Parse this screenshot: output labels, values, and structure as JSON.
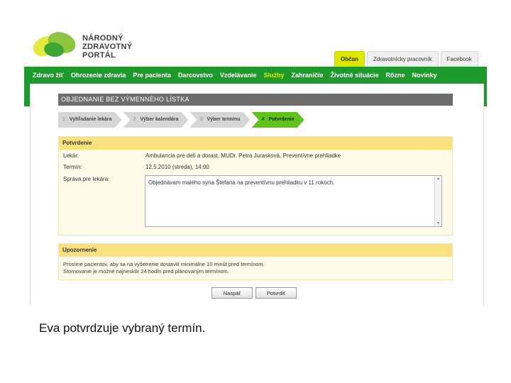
{
  "logo": {
    "line1": "NÁRODNÝ",
    "line2": "ZDRAVOTNÝ",
    "line3": "PORTÁL"
  },
  "top_tabs": [
    {
      "label": "Občan",
      "active": true
    },
    {
      "label": "Zdravotnícky pracovník",
      "active": false
    },
    {
      "label": "Facebook",
      "active": false
    }
  ],
  "nav": [
    {
      "label": "Zdravo žiť",
      "active": false
    },
    {
      "label": "Ohrozenie zdravia",
      "active": false
    },
    {
      "label": "Pre pacienta",
      "active": false
    },
    {
      "label": "Darcovstvo",
      "active": false
    },
    {
      "label": "Vzdelávanie",
      "active": false
    },
    {
      "label": "Služby",
      "active": true
    },
    {
      "label": "Zahraničie",
      "active": false
    },
    {
      "label": "Životné situácie",
      "active": false
    },
    {
      "label": "Rôzne",
      "active": false
    },
    {
      "label": "Novinky",
      "active": false
    }
  ],
  "page_title": "OBJEDNANIE BEZ VÝMENNÉHO LÍSTKA",
  "steps": [
    {
      "num": "1",
      "label": "Vyhľadanie lekára",
      "active": false
    },
    {
      "num": "2",
      "label": "Výber kalendára",
      "active": false
    },
    {
      "num": "3",
      "label": "Výber termínu",
      "active": false
    },
    {
      "num": "4",
      "label": "Potvrdenie",
      "active": true
    }
  ],
  "confirm": {
    "heading": "Potvrdenie",
    "doctor_label": "Lekár:",
    "doctor_value": "Ambulancia pre deti a dorast, MUDr. Petra Jurasková, Preventívne prehliadke",
    "term_label": "Termín:",
    "term_value": "12.5.2010 (streda), 14:00",
    "message_label": "Správa pre lekára:",
    "message_value": "Objednávam malého syna Štefana na preventívnu prehliadku v 11 rokoch."
  },
  "warning": {
    "heading": "Upozornenie",
    "line1": "Prosíme pacientov, aby sa na vyšetrenie dostavili minimálne 10 minút pred termínom.",
    "line2": "Stornovanie je možné najneskôr 24 hodín pred plánovaným termínom."
  },
  "buttons": {
    "back": "Naspäť",
    "confirm": "Potvrdiť"
  },
  "caption": "Eva potvrdzuje vybraný termín.",
  "colors": {
    "nav_green": "#1c9a2c",
    "step_active": "#61c21a",
    "panel_head": "#f8e17e",
    "tab_active": "#dce800"
  }
}
